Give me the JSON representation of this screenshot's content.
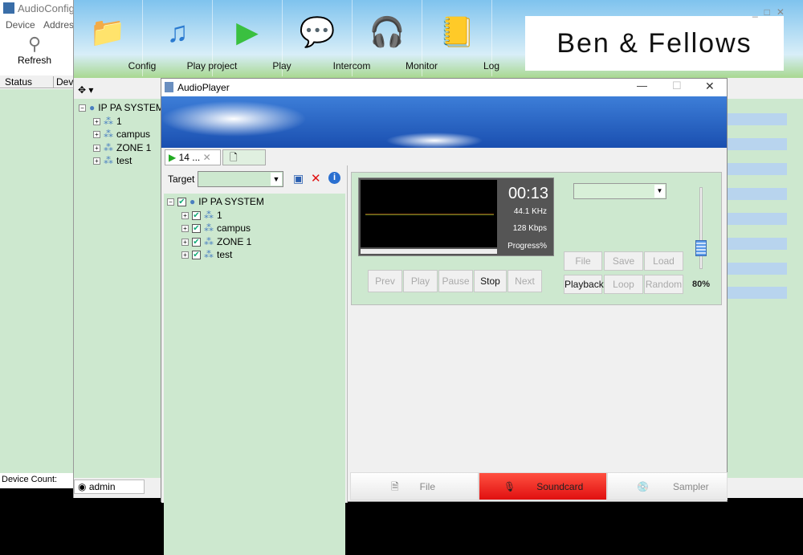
{
  "config_window": {
    "title": "AudioConfig",
    "menu": [
      "Device",
      "Address"
    ],
    "refresh_label": "Refresh",
    "columns": [
      "Status",
      "Dev"
    ],
    "device_count_label": "Device Count:"
  },
  "main_window": {
    "toolbar": [
      {
        "label": "Config",
        "icon": "folder-gear-icon"
      },
      {
        "label": "Play project",
        "icon": "music-disc-icon"
      },
      {
        "label": "Play",
        "icon": "play-icon"
      },
      {
        "label": "Intercom",
        "icon": "chat-bubble-icon"
      },
      {
        "label": "Monitor",
        "icon": "headphones-icon"
      },
      {
        "label": "Log",
        "icon": "notebook-icon"
      }
    ],
    "logo_text": "Ben & Fellows",
    "tree": {
      "root": "IP PA SYSTEM",
      "children": [
        "1",
        "campus",
        "ZONE 1",
        "test"
      ]
    },
    "user": "admin"
  },
  "player": {
    "title": "AudioPlayer",
    "tab_label": "14 ...",
    "target_label": "Target",
    "target_value": "",
    "tree": {
      "root": "IP PA SYSTEM",
      "children": [
        "1",
        "campus",
        "ZONE 1",
        "test"
      ]
    },
    "time": "00:13",
    "sample_rate": "44.1 KHz",
    "bitrate": "128 Kbps",
    "progress_label": "Progress%",
    "transport": [
      "Prev",
      "Play",
      "Pause",
      "Stop",
      "Next"
    ],
    "file_buttons": [
      "File",
      "Save",
      "Load"
    ],
    "mode_buttons": [
      "Playback",
      "Loop",
      "Random"
    ],
    "volume_percent": "80%",
    "volume": 80,
    "sources": [
      "File",
      "Soundcard",
      "Sampler"
    ],
    "active_source": "Soundcard",
    "colors": {
      "active_source": "#e8201c",
      "accent": "#cde8cf"
    }
  }
}
